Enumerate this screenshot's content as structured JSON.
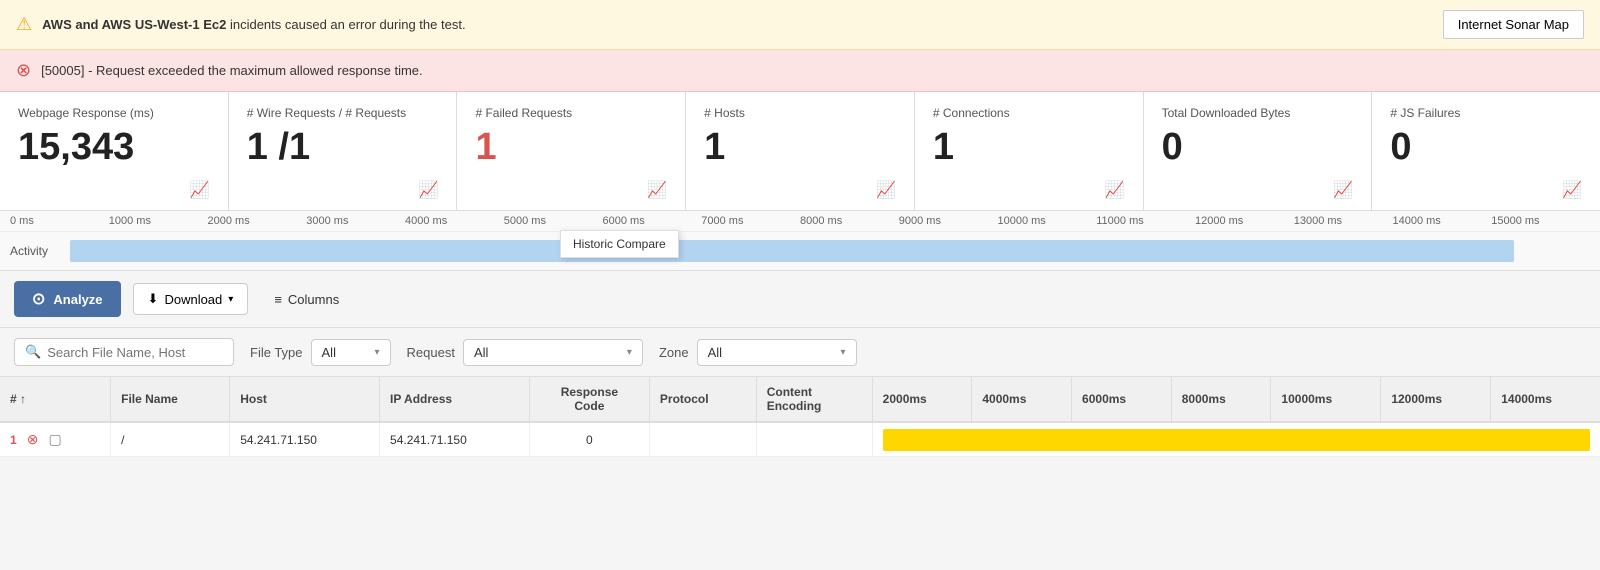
{
  "alerts": {
    "warning_text_bold": "AWS and AWS US-West-1 Ec2",
    "warning_text": " incidents caused an error during the test.",
    "error_text": "[50005] - Request exceeded the maximum allowed response time.",
    "internet_sonar_button": "Internet Sonar Map"
  },
  "metrics": [
    {
      "id": "webpage-response",
      "label": "Webpage Response (ms)",
      "value": "15,343",
      "red": false
    },
    {
      "id": "wire-requests",
      "label": "# Wire Requests / # Requests",
      "value": "1 /1",
      "red": false
    },
    {
      "id": "failed-requests",
      "label": "# Failed Requests",
      "value": "1",
      "red": true
    },
    {
      "id": "hosts",
      "label": "# Hosts",
      "value": "1",
      "red": false
    },
    {
      "id": "connections",
      "label": "# Connections",
      "value": "1",
      "red": false
    },
    {
      "id": "downloaded-bytes",
      "label": "Total Downloaded Bytes",
      "value": "0",
      "red": false
    },
    {
      "id": "js-failures",
      "label": "# JS Failures",
      "value": "0",
      "red": false
    }
  ],
  "timeline": {
    "labels": [
      "0 ms",
      "1000 ms",
      "2000 ms",
      "3000 ms",
      "4000 ms",
      "5000 ms",
      "6000 ms",
      "7000 ms",
      "8000 ms",
      "9000 ms",
      "10000 ms",
      "11000 ms",
      "12000 ms",
      "13000 ms",
      "14000 ms",
      "15000 ms"
    ],
    "activity_label": "Activity",
    "tooltip": "Historic Compare"
  },
  "toolbar": {
    "analyze_label": "Analyze",
    "download_label": "Download",
    "columns_label": "Columns"
  },
  "filters": {
    "search_placeholder": "Search File Name, Host",
    "file_type_label": "File Type",
    "file_type_value": "All",
    "request_label": "Request",
    "request_value": "All",
    "zone_label": "Zone",
    "zone_value": "All"
  },
  "table": {
    "columns": [
      {
        "id": "num",
        "label": "#"
      },
      {
        "id": "filename",
        "label": "File Name"
      },
      {
        "id": "host",
        "label": "Host"
      },
      {
        "id": "ip",
        "label": "IP Address"
      },
      {
        "id": "response_code",
        "label": "Response Code"
      },
      {
        "id": "protocol",
        "label": "Protocol"
      },
      {
        "id": "content_encoding",
        "label": "Content Encoding"
      },
      {
        "id": "t2000",
        "label": "2000ms"
      },
      {
        "id": "t4000",
        "label": "4000ms"
      },
      {
        "id": "t6000",
        "label": "6000ms"
      },
      {
        "id": "t8000",
        "label": "8000ms"
      },
      {
        "id": "t10000",
        "label": "10000ms"
      },
      {
        "id": "t12000",
        "label": "12000ms"
      },
      {
        "id": "t14000",
        "label": "14000ms"
      }
    ],
    "rows": [
      {
        "num": "1",
        "filename": "/",
        "host": "54.241.71.150",
        "ip": "54.241.71.150",
        "response_code": "0",
        "protocol": "",
        "content_encoding": "",
        "has_bar": true
      }
    ]
  }
}
